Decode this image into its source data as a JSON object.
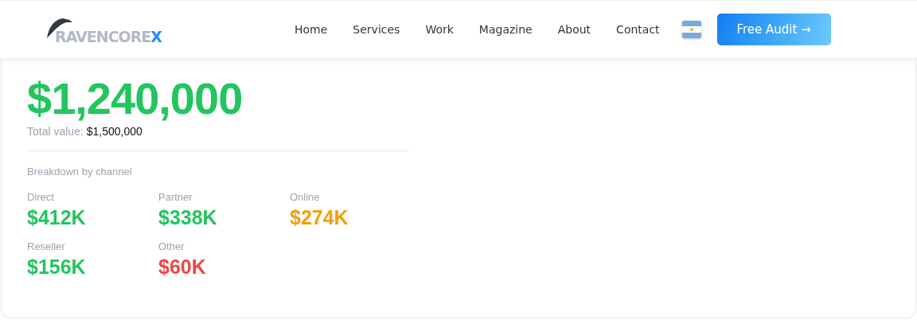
{
  "header": {
    "logo": {
      "text": "RAVENCORE",
      "accent": "X"
    },
    "nav": [
      {
        "label": "Home"
      },
      {
        "label": "Services"
      },
      {
        "label": "Work"
      },
      {
        "label": "Magazine"
      },
      {
        "label": "About"
      },
      {
        "label": "Contact"
      }
    ],
    "cta": "Free Audit →"
  },
  "summary": {
    "amount": "$1,240,000",
    "total_label": "Total value:",
    "total_value": "$1,500,000",
    "breakdown_title": "Breakdown by channel",
    "channels": [
      {
        "name": "Direct",
        "value": "$412K",
        "color": "#22c55e"
      },
      {
        "name": "Partner",
        "value": "$338K",
        "color": "#22c55e"
      },
      {
        "name": "Online",
        "value": "$274K",
        "color": "#f59e0b"
      },
      {
        "name": "Reseller",
        "value": "$156K",
        "color": "#22c55e"
      },
      {
        "name": "Other",
        "value": "$60K",
        "color": "#ef4444"
      }
    ]
  }
}
